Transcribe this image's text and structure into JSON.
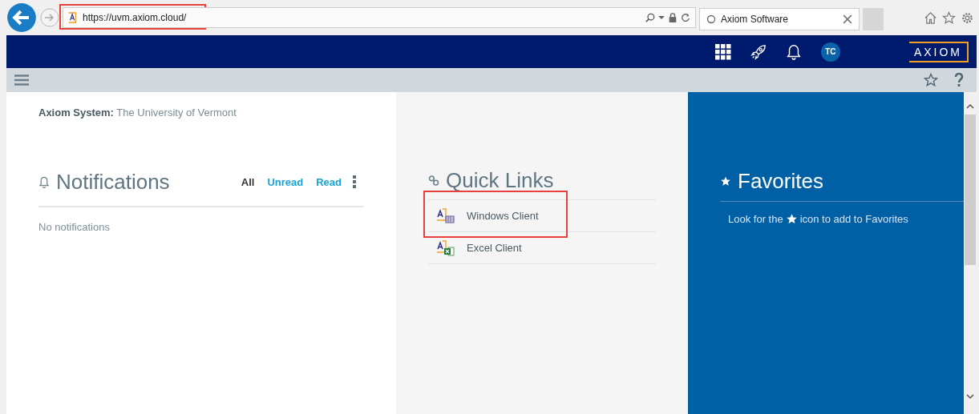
{
  "browser": {
    "address": {
      "url": "https://uvm.axiom.cloud/",
      "highlighted": true
    },
    "tab": {
      "title": "Axiom Software"
    }
  },
  "header": {
    "avatar": "TC",
    "logo": "AXIOM"
  },
  "system": {
    "label": "Axiom System:",
    "value": "The University of Vermont"
  },
  "notifications": {
    "title": "Notifications",
    "filters": [
      {
        "label": "All",
        "selected": true
      },
      {
        "label": "Unread",
        "selected": false
      },
      {
        "label": "Read",
        "selected": false
      }
    ],
    "empty": "No notifications"
  },
  "quick_links": {
    "title": "Quick Links",
    "links": [
      {
        "label": "Windows Client",
        "kind": "windows",
        "highlighted": true
      },
      {
        "label": "Excel Client",
        "kind": "excel",
        "highlighted": false
      }
    ]
  },
  "favorites": {
    "title": "Favorites",
    "hint_before": "Look for the",
    "hint_after": "icon to add to Favorites"
  }
}
